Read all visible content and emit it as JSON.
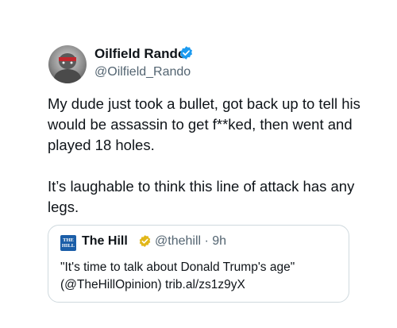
{
  "author": {
    "name": "Oilfield Rando",
    "handle": "@Oilfield_Rando",
    "verified_color": "#1d9bf0",
    "avatar_icon": "profile-photo"
  },
  "tweet": {
    "paragraphs": [
      "My dude just took a bullet, got back up to tell his would be assassin to get f**ked, then went and played 18 holes.",
      "It’s laughable to think this line of attack has any legs."
    ]
  },
  "quote": {
    "name": "The Hill",
    "logo_lines": [
      "THE",
      "HILL"
    ],
    "handle_time": "@thehill · 9h",
    "verified_color": "#e2b719",
    "text_lines": [
      "\"It's time to talk about Donald Trump's age\"",
      "(@TheHillOpinion) trib.al/zs1z9yX"
    ]
  }
}
